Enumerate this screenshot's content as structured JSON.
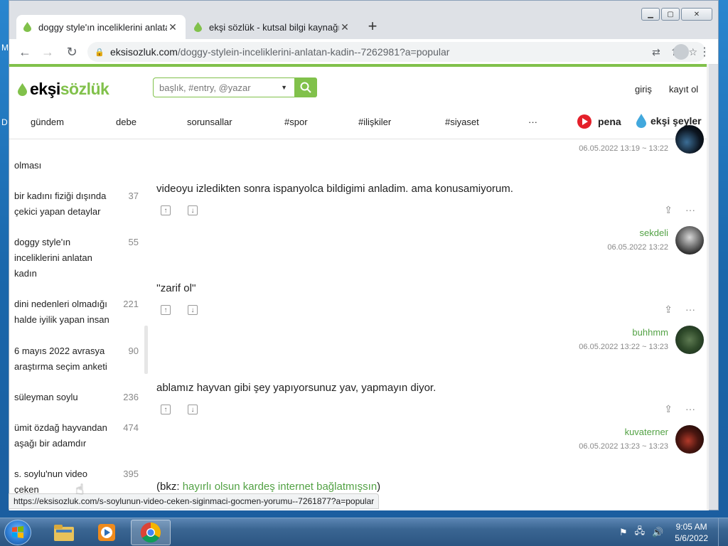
{
  "browser": {
    "tabs": [
      {
        "title": "doggy style'ın inceliklerini anlatan",
        "active": true
      },
      {
        "title": "ekşi sözlük - kutsal bilgi kaynağı",
        "active": false
      }
    ],
    "url_domain": "eksisozluk.com",
    "url_path": "/doggy-stylein-inceliklerini-anlatan-kadin--7262981?a=popular",
    "status_url": "https://eksisozluk.com/s-soylunun-video-ceken-siginmaci-gocmen-yorumu--7261877?a=popular"
  },
  "site": {
    "logo_prefix": "ekşi",
    "logo_suffix": "sözlük",
    "search_placeholder": "başlık, #entry, @yazar",
    "login": "giriş",
    "register": "kayıt ol",
    "menu": [
      "gündem",
      "debe",
      "sorunsallar",
      "#spor",
      "#ilişkiler",
      "#siyaset",
      "···"
    ],
    "pena": "pena",
    "eksi_seyler": "ekşi şeyler",
    "brand_green": "#81c14b"
  },
  "sidebar": {
    "items": [
      {
        "title": "olması",
        "count": ""
      },
      {
        "title": "bir kadını fiziği dışında çekici yapan detaylar",
        "count": "37"
      },
      {
        "title": "doggy style'ın inceliklerini anlatan kadın",
        "count": "55"
      },
      {
        "title": "dini nedenleri olmadığı halde iyilik yapan insan",
        "count": "221"
      },
      {
        "title": "6 mayıs 2022 avrasya araştırma seçim anketi",
        "count": "90"
      },
      {
        "title": "süleyman soylu",
        "count": "236"
      },
      {
        "title": "ümit özdağ hayvandan aşağı bir adamdır",
        "count": "474"
      },
      {
        "title": "s. soylu'nun video çeken",
        "count": "395"
      }
    ]
  },
  "entries": [
    {
      "author": "",
      "date": "06.05.2022 13:19 ~ 13:22",
      "text": ""
    },
    {
      "text": "videoyu izledikten sonra ispanyolca bildigimi anladim. ama konusamiyorum.",
      "author": "sekdeli",
      "date": "06.05.2022 13:22"
    },
    {
      "text": "''zarif ol''",
      "author": "buhhmm",
      "date": "06.05.2022 13:22 ~ 13:23"
    },
    {
      "text": "ablamız hayvan gibi şey yapıyorsunuz yav, yapmayın diyor.",
      "author": "kuvaterner",
      "date": "06.05.2022 13:23 ~ 13:23"
    },
    {
      "text_prefix": "(bkz: ",
      "text_link": "hayırlı olsun kardeş internet bağlatmışsın",
      "text_suffix": ")"
    }
  ],
  "taskbar": {
    "time": "9:05 AM",
    "date": "5/6/2022"
  },
  "desktop": {
    "mark1": "M",
    "mark2": "D"
  }
}
